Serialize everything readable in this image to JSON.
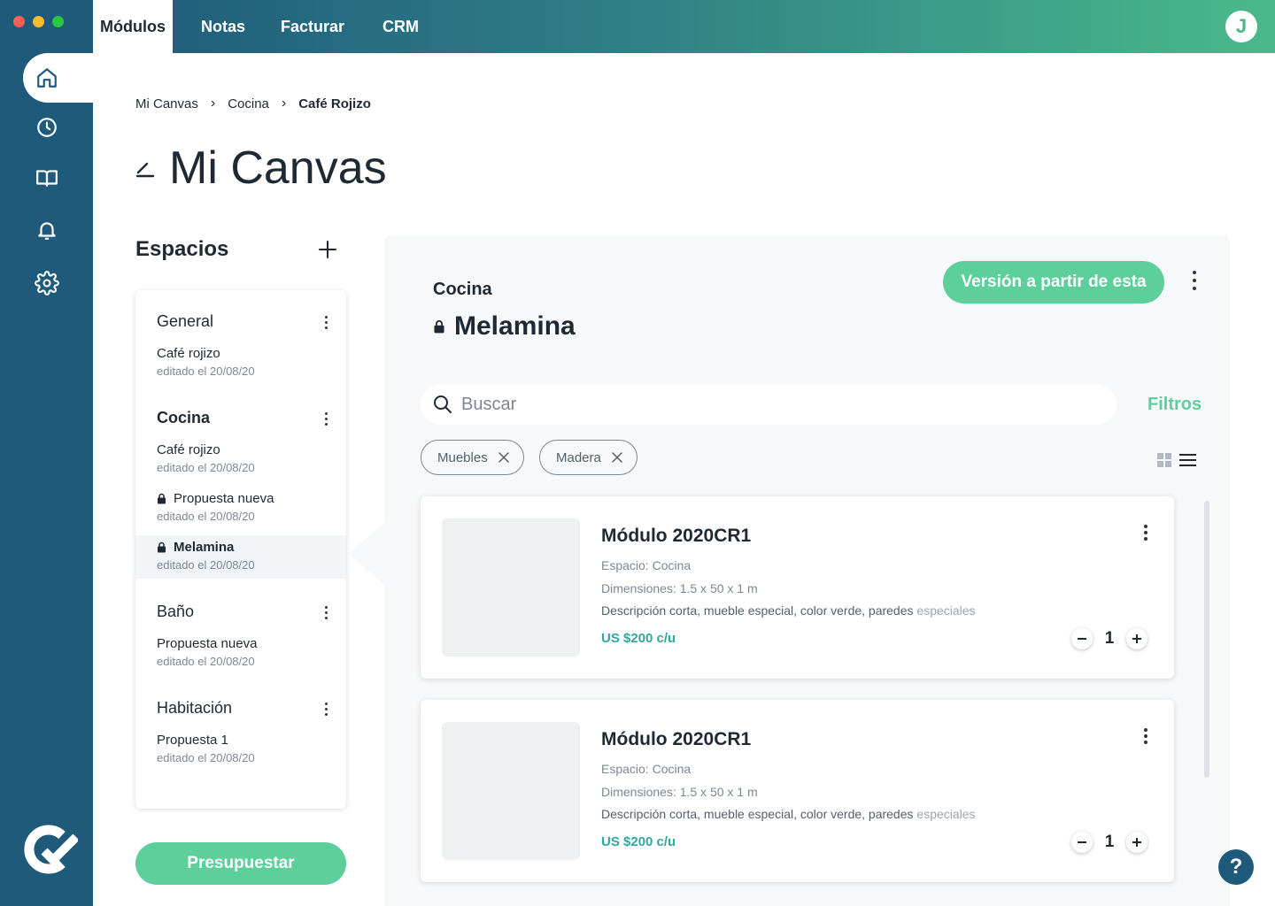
{
  "colors": {
    "rail": "#1f5a7a",
    "accent": "#5dcf9b",
    "price": "#2fa7a0",
    "panel": "#f7f8f9"
  },
  "window": {
    "traffic_lights": [
      "#ff5f57",
      "#febc2e",
      "#28c840"
    ]
  },
  "rail": {
    "items": [
      {
        "icon": "home-icon",
        "active": true
      },
      {
        "icon": "clock-icon",
        "active": false
      },
      {
        "icon": "book-icon",
        "active": false
      },
      {
        "icon": "bell-icon",
        "active": false
      },
      {
        "icon": "gear-icon",
        "active": false
      }
    ],
    "logo": "brand-logo"
  },
  "topbar": {
    "tabs": [
      "Módulos",
      "Notas",
      "Facturar",
      "CRM"
    ],
    "active_tab": "Módulos",
    "user_initial": "J"
  },
  "breadcrumb": [
    "Mi Canvas",
    "Cocina",
    "Café Rojizo"
  ],
  "page": {
    "title": "Mi Canvas",
    "title_icon": "edit-pencil-icon"
  },
  "spaces": {
    "heading": "Espacios",
    "groups": [
      {
        "name": "General",
        "versions": [
          {
            "name": "Café rojizo",
            "date": "editado el 20/08/20",
            "locked": false
          }
        ]
      },
      {
        "name": "Cocina",
        "versions": [
          {
            "name": "Café rojizo",
            "date": "editado el 20/08/20",
            "locked": false
          },
          {
            "name": "Propuesta nueva",
            "date": "editado el 20/08/20",
            "locked": true
          },
          {
            "name": "Melamina",
            "date": "editado el 20/08/20",
            "locked": true,
            "selected": true
          }
        ]
      },
      {
        "name": "Baño",
        "versions": [
          {
            "name": "Propuesta nueva",
            "date": "editado el 20/08/20",
            "locked": false
          }
        ]
      },
      {
        "name": "Habitación",
        "versions": [
          {
            "name": "Propuesta 1",
            "date": "editado el 20/08/20",
            "locked": false
          }
        ]
      }
    ],
    "budget_button": "Presupuestar"
  },
  "detail": {
    "space": "Cocina",
    "version": "Melamina",
    "version_button": "Versión a partir de esta",
    "search_placeholder": "Buscar",
    "filters_label": "Filtros",
    "chips": [
      "Muebles",
      "Madera"
    ],
    "products": [
      {
        "name": "Módulo 2020CR1",
        "space": "Espacio: Cocina",
        "dimensions": "Dimensiones: 1.5 x 50 x 1 m",
        "description": "Descripción corta, mueble especial, color verde, paredes ",
        "description_fade": "especiales",
        "price": "US $200 c/u",
        "qty": "1"
      },
      {
        "name": "Módulo 2020CR1",
        "space": "Espacio: Cocina",
        "dimensions": "Dimensiones: 1.5 x 50 x 1 m",
        "description": "Descripción corta, mueble especial, color verde, paredes ",
        "description_fade": "especiales",
        "price": "US $200 c/u",
        "qty": "1"
      }
    ]
  },
  "help": {
    "label": "?"
  }
}
